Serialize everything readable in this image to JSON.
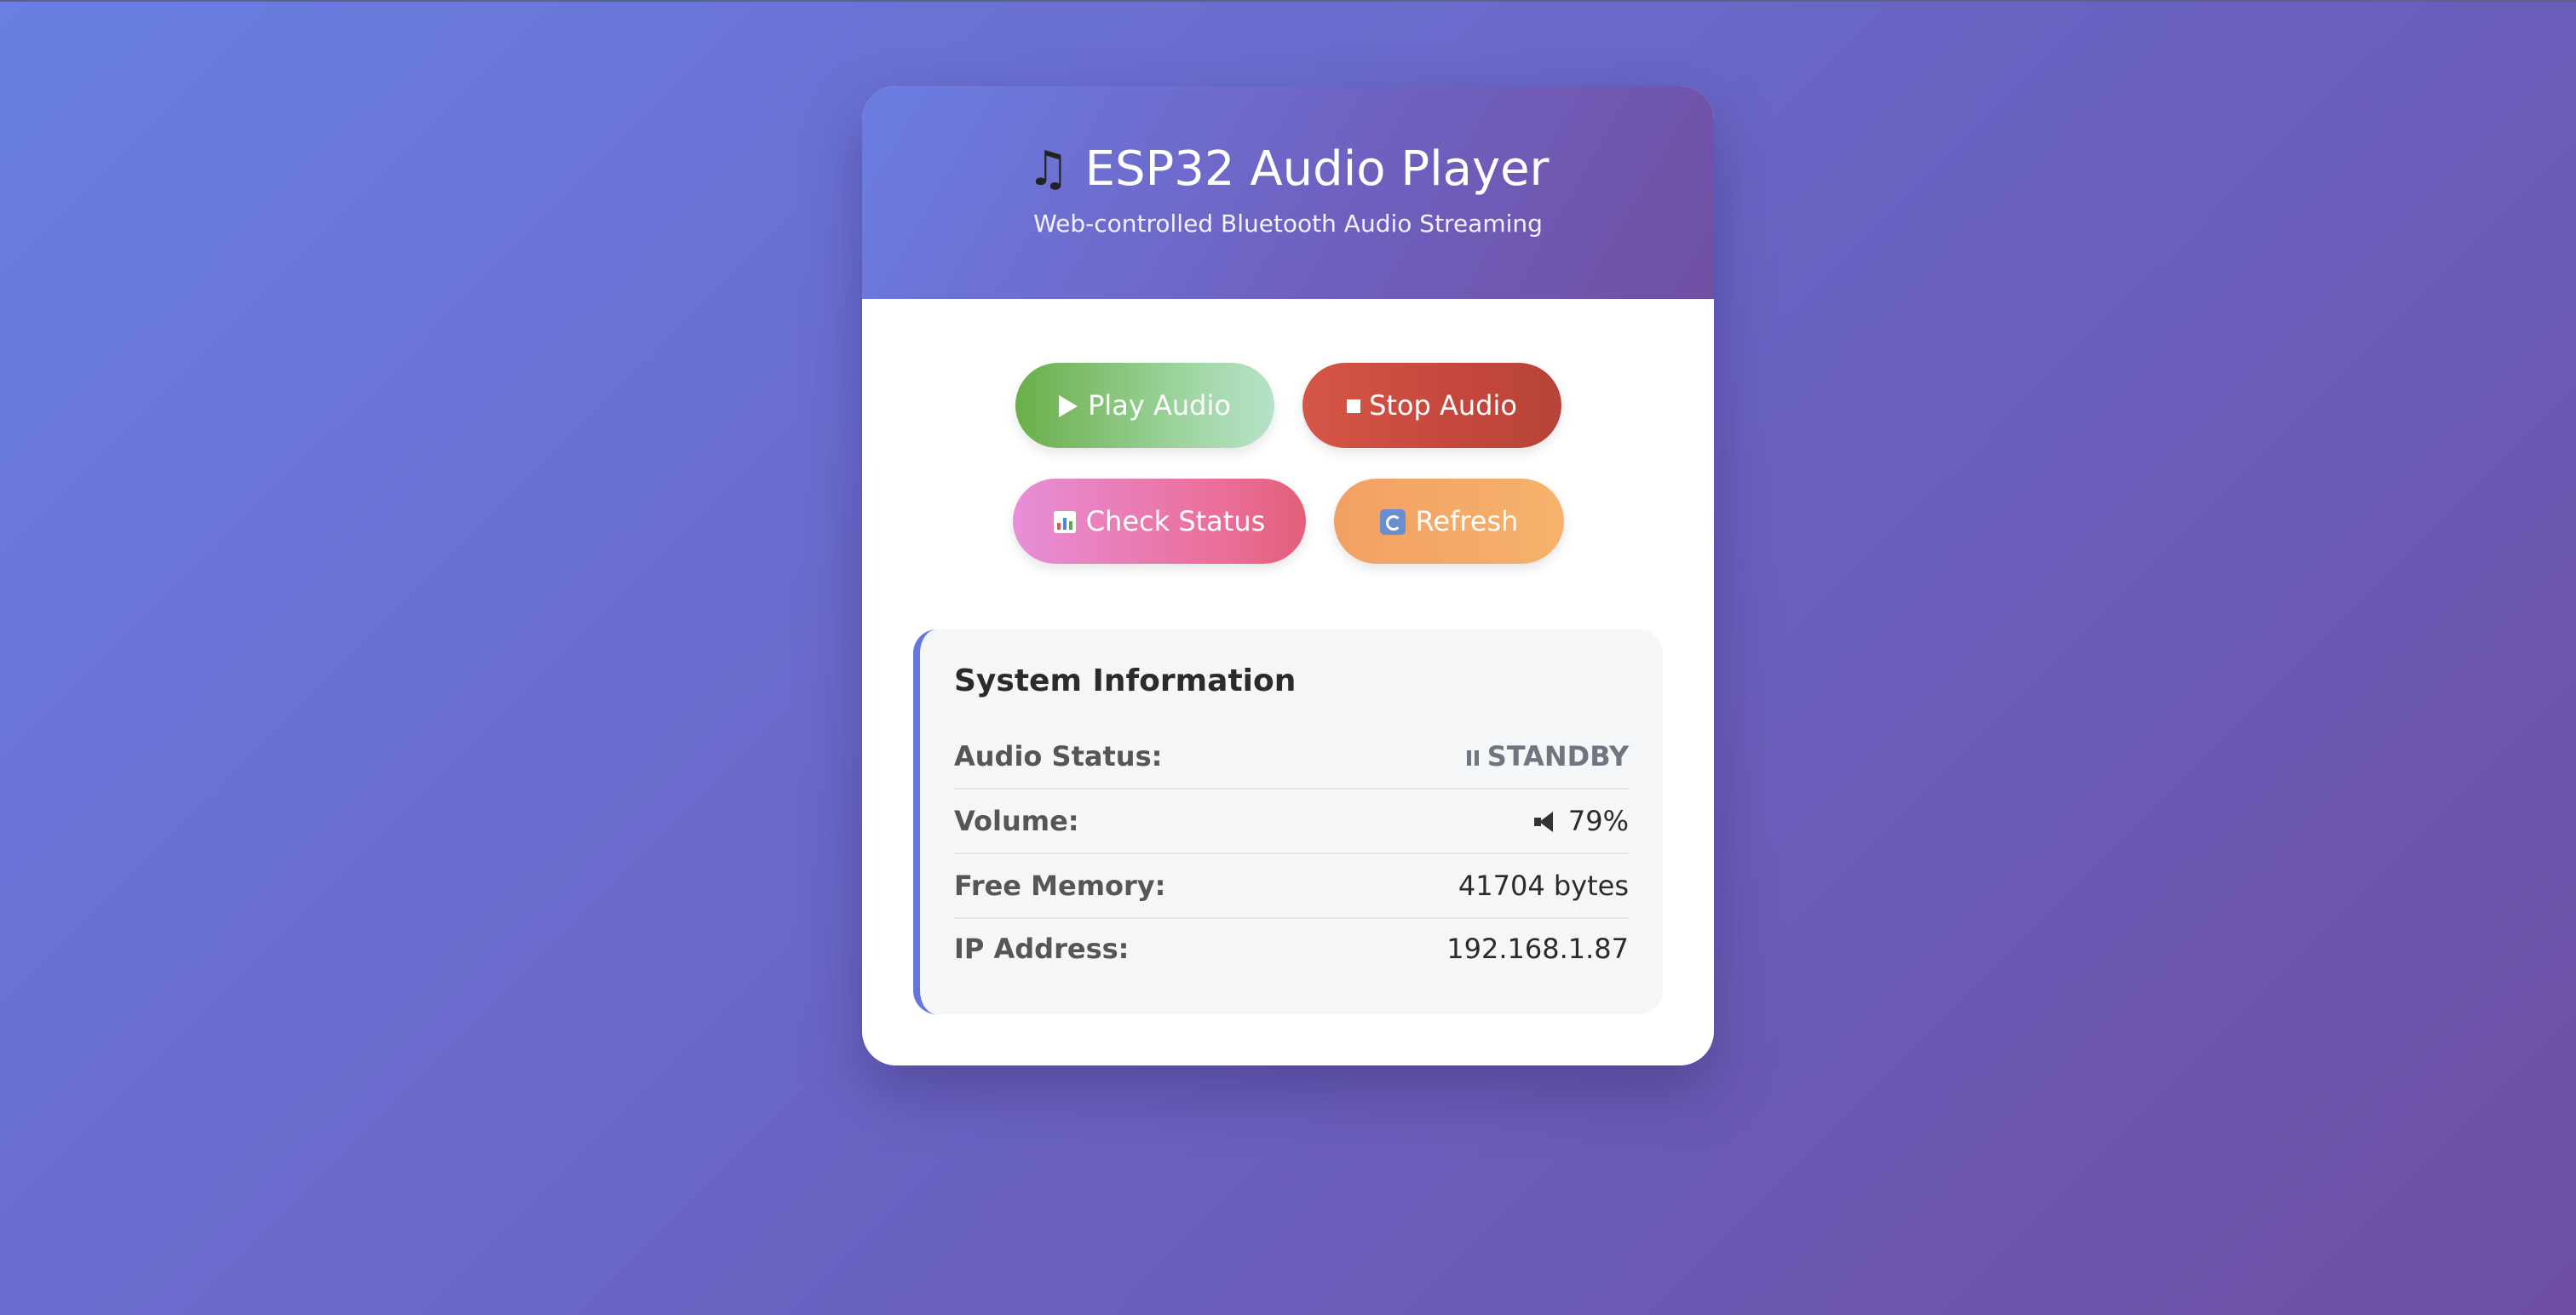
{
  "header": {
    "title_icon": "musical-note-icon",
    "title": "ESP32 Audio Player",
    "subtitle": "Web-controlled Bluetooth Audio Streaming"
  },
  "controls": {
    "play_label": "Play Audio",
    "stop_label": "Stop Audio",
    "status_label": "Check Status",
    "refresh_label": "Refresh",
    "play_icon": "play-icon",
    "stop_icon": "stop-icon",
    "status_icon": "bar-chart-icon",
    "refresh_icon": "refresh-icon"
  },
  "system_info": {
    "title": "System Information",
    "rows": [
      {
        "label": "Audio Status:",
        "value": "STANDBY",
        "icon": "pause-icon"
      },
      {
        "label": "Volume:",
        "value": "79%",
        "icon": "speaker-icon"
      },
      {
        "label": "Free Memory:",
        "value": "41704 bytes"
      },
      {
        "label": "IP Address:",
        "value": "192.168.1.87"
      }
    ]
  },
  "colors": {
    "background_start": "#6a7fe3",
    "background_end": "#6d4ea3",
    "play": "#6aae4a",
    "stop": "#d65646",
    "status": "#e88ed8",
    "refresh": "#f2a064",
    "info_accent": "#6577dc"
  }
}
